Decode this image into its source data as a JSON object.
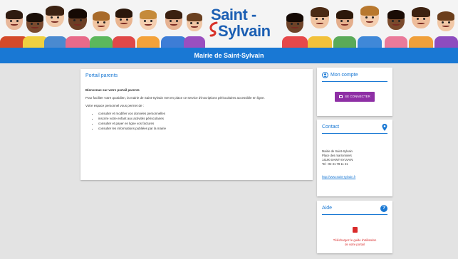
{
  "header": {
    "logo_line1": "Saint -",
    "logo_line2": "Sylvain",
    "title": "Mairie de Saint-Sylvain"
  },
  "main": {
    "title": "Portail parents",
    "welcome": "Bienvenue sur votre portail parents",
    "intro": "Pour faciliter votre quotidien, la mairie de Saint-Sylvain met en place ce service d'inscriptions périscolaires accessible en ligne.",
    "space_intro": "Votre espace personnel vous permet de :",
    "bullets": [
      "consulter et modifier vos données personnelles",
      "inscrire votre enfant aux activités périscolaires",
      "consulter et payer en ligne vos factures",
      "consulter les informations publiées par la mairie"
    ]
  },
  "account": {
    "title": "Mon compte",
    "connect_label": "SE CONNECTER"
  },
  "contact": {
    "title": "Contact",
    "lines": [
      "Mairie de Saint-Sylvain",
      "Place des marronniers",
      "14190 SAINT-SYLVAIN",
      "Tel : 02 31 78 11 21"
    ],
    "link": "http://www.saint-sylvain.fr"
  },
  "help": {
    "title": "Aide",
    "line1": "Téléchargez le guide d'utilisation",
    "line2": "de votre portail"
  },
  "colors": {
    "accent": "#1978d4",
    "button": "#8e2fa5",
    "help": "#d92b2b"
  }
}
